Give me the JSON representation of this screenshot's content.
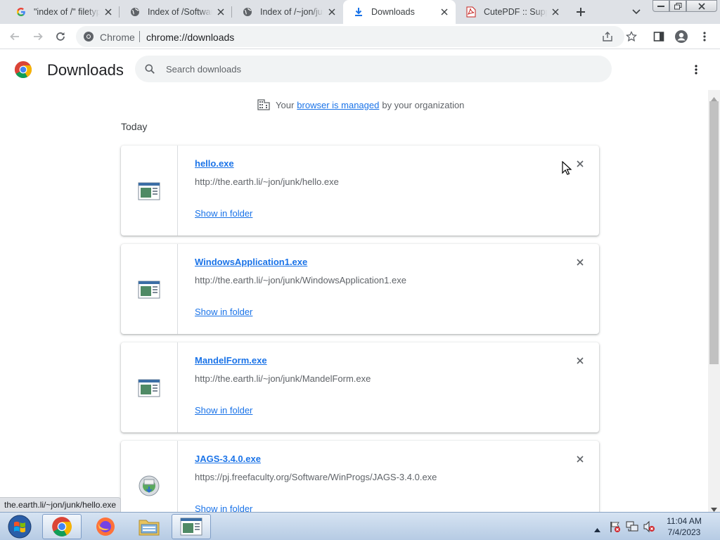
{
  "tabs": [
    {
      "title": "\"index of /\" filetype",
      "icon": "google-g-icon"
    },
    {
      "title": "Index of /Software",
      "icon": "globe-icon"
    },
    {
      "title": "Index of /~jon/junk",
      "icon": "globe-icon"
    },
    {
      "title": "Downloads",
      "icon": "download-icon"
    },
    {
      "title": "CutePDF :: Support",
      "icon": "pdf-icon"
    }
  ],
  "omnibox": {
    "scheme_label": "Chrome",
    "url": "chrome://downloads"
  },
  "page": {
    "title": "Downloads",
    "search_placeholder": "Search downloads"
  },
  "managed": {
    "before": "Your",
    "link": "browser is managed",
    "after": "by your organization"
  },
  "section_label": "Today",
  "downloads": [
    {
      "name": "hello.exe",
      "url": "http://the.earth.li/~jon/junk/hello.exe",
      "action": "Show in folder"
    },
    {
      "name": "WindowsApplication1.exe",
      "url": "http://the.earth.li/~jon/junk/WindowsApplication1.exe",
      "action": "Show in folder"
    },
    {
      "name": "MandelForm.exe",
      "url": "http://the.earth.li/~jon/junk/MandelForm.exe",
      "action": "Show in folder"
    },
    {
      "name": "JAGS-3.4.0.exe",
      "url": "https://pj.freefaculty.org/Software/WinProgs/JAGS-3.4.0.exe",
      "action": "Show in folder"
    }
  ],
  "status_bubble": "the.earth.li/~jon/junk/hello.exe",
  "clock": {
    "time": "11:04 AM",
    "date": "7/4/2023"
  },
  "colors": {
    "accent": "#1a73e8",
    "tabstrip": "#dee1e6"
  }
}
